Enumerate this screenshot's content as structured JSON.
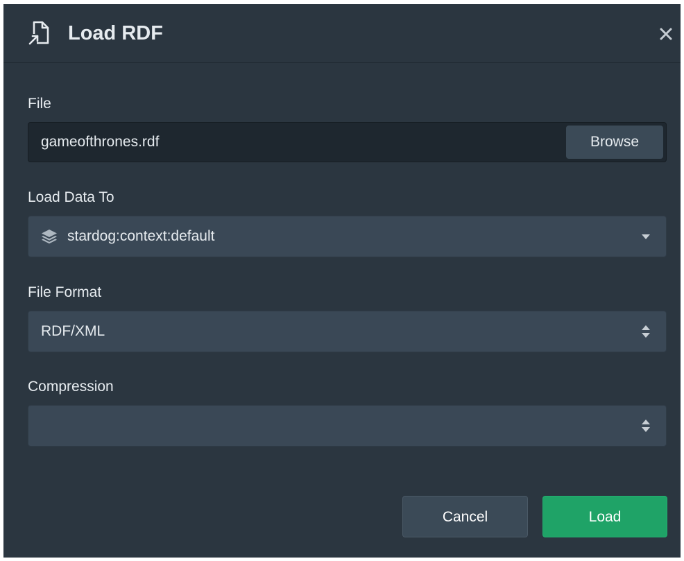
{
  "dialog": {
    "title": "Load RDF"
  },
  "file": {
    "label": "File",
    "value": "gameofthrones.rdf",
    "browse_label": "Browse"
  },
  "load_to": {
    "label": "Load Data To",
    "value": "stardog:context:default"
  },
  "file_format": {
    "label": "File Format",
    "value": "RDF/XML"
  },
  "compression": {
    "label": "Compression",
    "value": ""
  },
  "footer": {
    "cancel_label": "Cancel",
    "load_label": "Load"
  },
  "colors": {
    "background": "#2b3640",
    "input_dark": "#1e272f",
    "select_bg": "#3a4856",
    "primary_green": "#1fa367",
    "text": "#e6ebef"
  },
  "icons": {
    "header": "file-import-icon",
    "close": "close-icon",
    "load_to": "layers-icon",
    "load_to_caret": "caret-down-icon",
    "format_caret": "sort-updown-icon",
    "compression_caret": "sort-updown-icon"
  }
}
